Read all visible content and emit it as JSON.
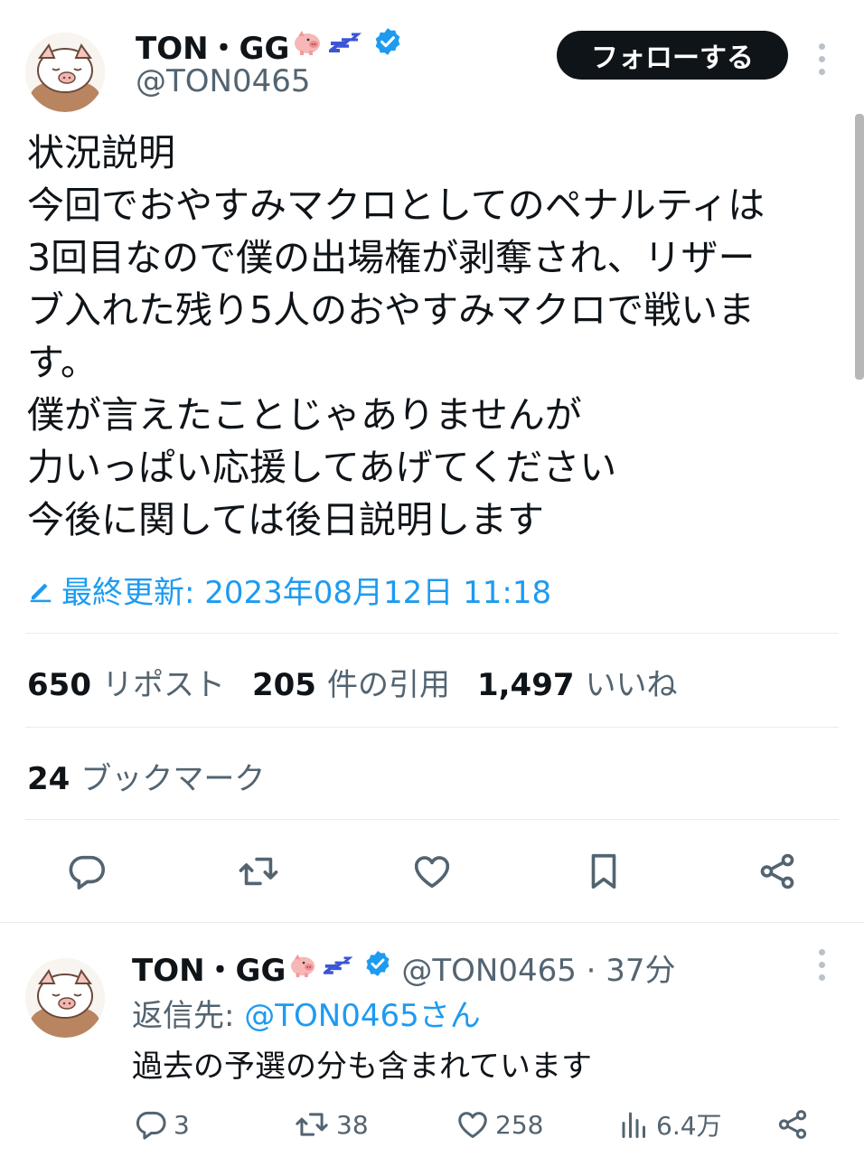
{
  "tweet": {
    "author": {
      "name": "TON・GG",
      "handle": "@TON0465"
    },
    "follow_label": "フォローする",
    "text_lines": [
      "状況説明",
      "今回でおやすみマクロとしてのペナルティは",
      "3回目なので僕の出場権が剥奪され、リザー",
      "ブ入れた残り5人のおやすみマクロで戦いま",
      "す。",
      "僕が言えたことじゃありませんが",
      "力いっぱい応援してあげてください",
      "今後に関しては後日説明します"
    ],
    "edited_label": "最終更新: 2023年08月12日 11:18",
    "stats": {
      "reposts_count": "650",
      "reposts_label": "リポスト",
      "quotes_count": "205",
      "quotes_label": "件の引用",
      "likes_count": "1,497",
      "likes_label": "いいね",
      "bookmarks_count": "24",
      "bookmarks_label": "ブックマーク"
    },
    "actions": [
      "reply-icon",
      "repost-icon",
      "like-icon",
      "bookmark-icon",
      "share-icon"
    ]
  },
  "reply": {
    "name": "TON・GG",
    "handle_time": "@TON0465 · 37分",
    "reply_to_prefix": "返信先: ",
    "reply_to_mention": "@TON0465さん",
    "text": "過去の予選の分も含まれています",
    "counts": {
      "replies": "3",
      "reposts": "38",
      "likes": "258",
      "views": "6.4万"
    }
  },
  "colors": {
    "accent": "#1d9bf0",
    "text": "#0f1419",
    "muted": "#536471",
    "button_bg": "#0f1419"
  }
}
